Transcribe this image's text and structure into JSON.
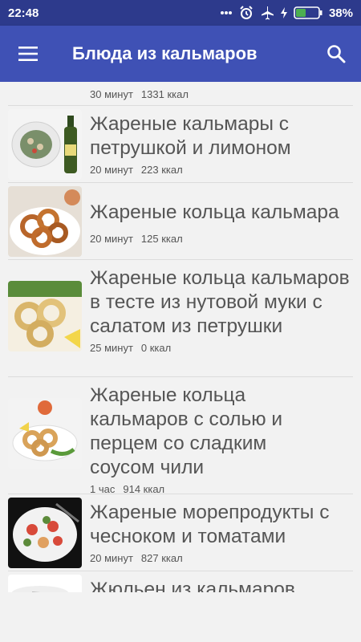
{
  "status": {
    "time": "22:48",
    "battery": "38%"
  },
  "app_bar": {
    "title": "Блюда из кальмаров"
  },
  "list": [
    {
      "name": "",
      "time": "30 минут",
      "kcal": "1331 ккал"
    },
    {
      "name": "Жареные кальмары с петрушкой и лимоном",
      "time": "20 минут",
      "kcal": "223 ккал"
    },
    {
      "name": "Жареные кольца кальмара",
      "time": "20 минут",
      "kcal": "125 ккал"
    },
    {
      "name": "Жареные кольца кальмаров в тесте из нутовой муки с салатом из петрушки",
      "time": "25 минут",
      "kcal": "0 ккал"
    },
    {
      "name": "Жареные кольца кальмаров с солью и перцем со сладким соусом чили",
      "time": "1 час",
      "kcal": "914 ккал"
    },
    {
      "name": "Жареные морепродукты с чесноком и томатами",
      "time": "20 минут",
      "kcal": "827 ккал"
    },
    {
      "name": "Жюльен из кальмаров",
      "time": "",
      "kcal": ""
    }
  ],
  "colors": {
    "status_bar": "#2d3a8c",
    "app_bar": "#3f51b5",
    "background": "#f2f2f2"
  }
}
